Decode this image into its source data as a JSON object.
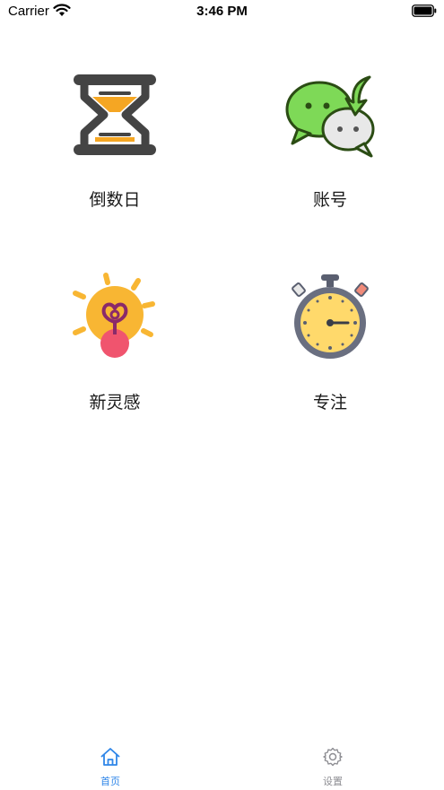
{
  "status_bar": {
    "carrier": "Carrier",
    "time": "3:46 PM",
    "wifi_icon": "wifi-icon",
    "battery_icon": "battery-icon"
  },
  "grid": {
    "items": [
      {
        "label": "倒数日",
        "icon": "hourglass-icon"
      },
      {
        "label": "账号",
        "icon": "chat-bubbles-icon"
      },
      {
        "label": "新灵感",
        "icon": "lightbulb-icon"
      },
      {
        "label": "专注",
        "icon": "stopwatch-icon"
      }
    ]
  },
  "tab_bar": {
    "tabs": [
      {
        "label": "首页",
        "icon": "home-icon",
        "active": true
      },
      {
        "label": "设置",
        "icon": "gear-icon",
        "active": false
      }
    ],
    "active_color": "#2f86e8",
    "inactive_color": "#8e8e93"
  }
}
